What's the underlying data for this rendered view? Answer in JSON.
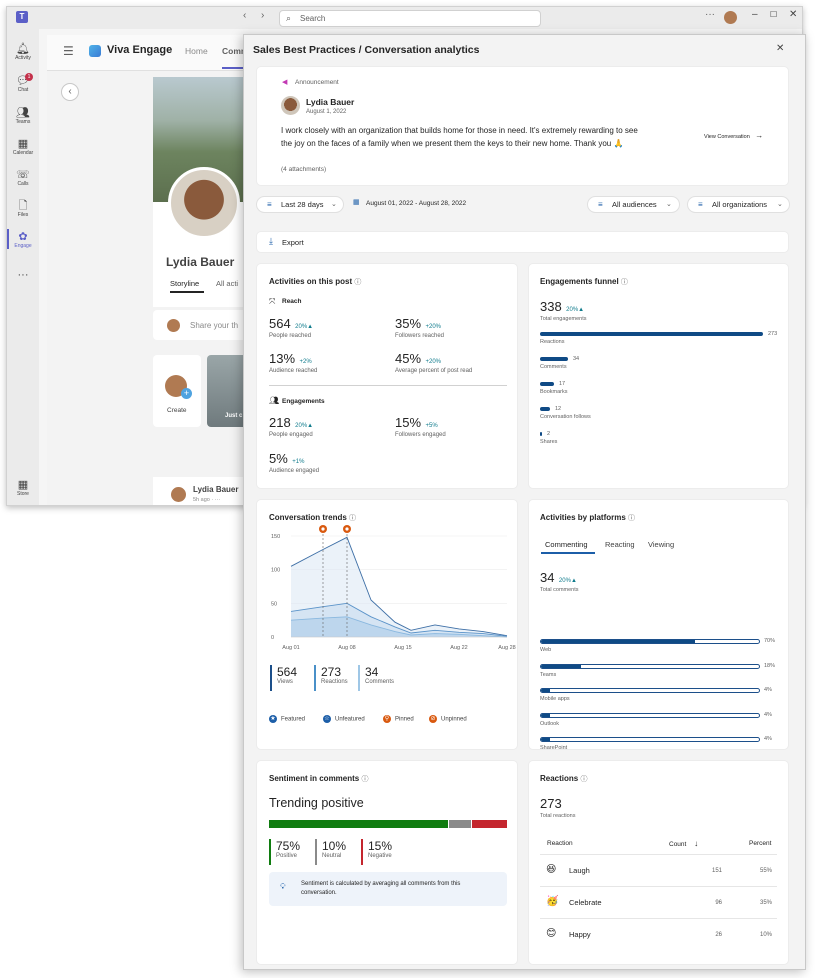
{
  "teams": {
    "search_placeholder": "Search",
    "rail": [
      {
        "label": "Activity",
        "icon": "bell-icon"
      },
      {
        "label": "Chat",
        "icon": "chat-icon",
        "badge": "1"
      },
      {
        "label": "Teams",
        "icon": "people-icon"
      },
      {
        "label": "Calendar",
        "icon": "calendar-icon"
      },
      {
        "label": "Calls",
        "icon": "phone-icon"
      },
      {
        "label": "Files",
        "icon": "file-icon"
      },
      {
        "label": "Engage",
        "icon": "engage-icon"
      },
      {
        "label": "Store",
        "icon": "grid-icon"
      }
    ],
    "app_name": "Viva Engage",
    "nav_tabs": [
      "Home",
      "Comm"
    ],
    "profile_name": "Lydia Bauer",
    "profile_tabs": [
      "Storyline",
      "All acti"
    ],
    "share_placeholder": "Share your th",
    "create_label": "Create",
    "story_label": "Just c",
    "post_author": "Lydia Bauer",
    "post_time": "5h ago  ·  ···"
  },
  "panel": {
    "title": "Sales Best Practices / Conversation analytics",
    "post": {
      "type": "Announcement",
      "author": "Lydia Bauer",
      "date": "August 1, 2022",
      "body": "I work closely with an organization that builds home for those in need. It's extremely rewarding to see the joy on the faces of a family when we present them the keys to their new home. Thank you 🙏",
      "attachments": "(4 attachments)",
      "view_link": "View Conversation"
    },
    "filters": {
      "range": "Last 28 days",
      "dates": "August 01, 2022 - August 28, 2022",
      "audiences": "All audiences",
      "organizations": "All organizations"
    },
    "export": "Export",
    "activities": {
      "title": "Activities on this post",
      "reach_title": "Reach",
      "reach": [
        {
          "value": "564",
          "delta": "20%",
          "label": "People reached"
        },
        {
          "value": "35%",
          "delta": "+20%",
          "label": "Followers reached"
        },
        {
          "value": "13%",
          "delta": "+2%",
          "label": "Audience reached"
        },
        {
          "value": "45%",
          "delta": "+20%",
          "label": "Average percent of post read"
        }
      ],
      "eng_title": "Engagements",
      "engagements": [
        {
          "value": "218",
          "delta": "20%",
          "label": "People engaged"
        },
        {
          "value": "15%",
          "delta": "+5%",
          "label": "Followers engaged"
        },
        {
          "value": "5%",
          "delta": "+1%",
          "label": "Audience engaged"
        }
      ]
    },
    "funnel": {
      "title": "Engagements funnel",
      "total": "338",
      "delta": "20%",
      "total_label": "Total engagements",
      "max": 273,
      "items": [
        {
          "label": "Reactions",
          "value": 273
        },
        {
          "label": "Comments",
          "value": 34
        },
        {
          "label": "Bookmarks",
          "value": 17
        },
        {
          "label": "Conversation follows",
          "value": 12
        },
        {
          "label": "Shares",
          "value": 2
        }
      ]
    },
    "trends": {
      "title": "Conversation trends",
      "stats": [
        {
          "value": "564",
          "label": "Views",
          "color": "#1c4f8a"
        },
        {
          "value": "273",
          "label": "Reactions",
          "color": "#4a90c8"
        },
        {
          "value": "34",
          "label": "Comments",
          "color": "#9fc7e6"
        }
      ],
      "legend": [
        {
          "label": "Featured",
          "icon": "star-icon",
          "color": "#1c5ea8"
        },
        {
          "label": "Unfeatured",
          "icon": "unstar-icon",
          "color": "#1c5ea8"
        },
        {
          "label": "Pinned",
          "icon": "pin-icon",
          "color": "#d9590f"
        },
        {
          "label": "Unpinned",
          "icon": "unpin-icon",
          "color": "#d9590f"
        }
      ]
    },
    "platforms": {
      "title": "Activities by platforms",
      "tabs": [
        "Commenting",
        "Reacting",
        "Viewing"
      ],
      "total": "34",
      "delta": "20%",
      "total_label": "Total comments",
      "items": [
        {
          "label": "Web",
          "pct": 70,
          "text": "70%"
        },
        {
          "label": "Teams",
          "pct": 18,
          "text": "18%"
        },
        {
          "label": "Mobile apps",
          "pct": 4,
          "text": "4%"
        },
        {
          "label": "Outlook",
          "pct": 4,
          "text": "4%"
        },
        {
          "label": "SharePoint",
          "pct": 4,
          "text": "4%"
        },
        {
          "label": "Others",
          "pct": 0,
          "text": "0%"
        }
      ]
    },
    "sentiment": {
      "title": "Sentiment in comments",
      "headline": "Trending positive",
      "items": [
        {
          "value": "75%",
          "label": "Positive",
          "pct": 75,
          "color": "#107c10"
        },
        {
          "value": "10%",
          "label": "Neutral",
          "pct": 10,
          "color": "#8a8a8a"
        },
        {
          "value": "15%",
          "label": "Negative",
          "pct": 15,
          "color": "#c4262e"
        }
      ],
      "note": "Sentiment is calculated by averaging all comments from this conversation."
    },
    "reactions": {
      "title": "Reactions",
      "total": "273",
      "total_label": "Total reactions",
      "headers": [
        "Reaction",
        "Count",
        "Percent"
      ],
      "rows": [
        {
          "name": "Laugh",
          "count": "151",
          "percent": "55%",
          "emoji": "😆"
        },
        {
          "name": "Celebrate",
          "count": "96",
          "percent": "35%",
          "emoji": "🥳"
        },
        {
          "name": "Happy",
          "count": "26",
          "percent": "10%",
          "emoji": "😊"
        }
      ]
    }
  },
  "chart_data": {
    "type": "area",
    "title": "Conversation trends",
    "x_ticks": [
      "Aug 01",
      "Aug 08",
      "Aug 15",
      "Aug 22",
      "Aug 28"
    ],
    "y_ticks": [
      "0",
      "50",
      "100",
      "150"
    ],
    "ylim": [
      0,
      150
    ],
    "x": [
      1,
      5,
      8,
      11,
      14,
      16,
      19,
      22,
      25,
      28
    ],
    "series": [
      {
        "name": "Views",
        "values": [
          105,
          130,
          148,
          55,
          22,
          10,
          18,
          12,
          8,
          2
        ]
      },
      {
        "name": "Reactions",
        "values": [
          38,
          45,
          50,
          30,
          15,
          6,
          10,
          7,
          5,
          1
        ]
      },
      {
        "name": "Comments",
        "values": [
          25,
          28,
          30,
          18,
          8,
          3,
          5,
          4,
          2,
          0
        ]
      }
    ],
    "markers": [
      {
        "x": 5,
        "type": "pin"
      },
      {
        "x": 8,
        "type": "pin"
      }
    ]
  }
}
